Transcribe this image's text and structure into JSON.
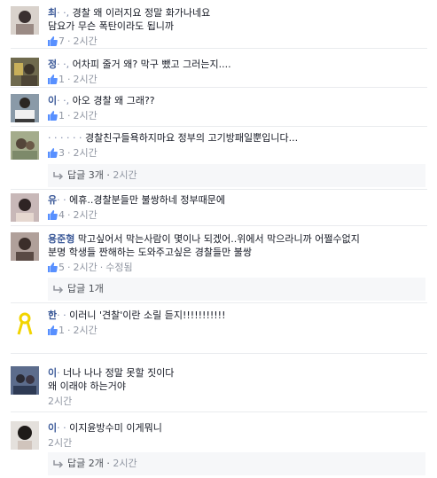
{
  "comments": [
    {
      "author": "최",
      "text": "경찰 왜 이러지요 정말 화가나네요",
      "text2": "담요가 무슨 폭탄이라도 됩니까",
      "likes": "7",
      "time": "2시간"
    },
    {
      "author": "정",
      "text": "어차피 줄거 왜? 막구 뺐고 그러는지....",
      "likes": "1",
      "time": "2시간"
    },
    {
      "author": "이",
      "text": "아오 경찰 왜 그래??",
      "likes": "1",
      "time": "2시간"
    },
    {
      "author": "",
      "text": "경찰친구들욕하지마요 정부의 고기방패일뿐입니다...",
      "likes": "3",
      "time": "2시간"
    },
    {
      "author": "유",
      "text": "에휴..경찰분들만 불쌍하네 정부때문에",
      "likes": "4",
      "time": "2시간"
    },
    {
      "author": "용준형",
      "text": "막고싶어서 막는사람이 몇이나 되겠어..위에서 막으라니까 어쩔수없지",
      "text2": "분명 학생들 짠해하는 도와주고싶은 경찰들만 불쌍",
      "likes": "5",
      "time": "2시간",
      "edited": "수정됨"
    },
    {
      "author": "한",
      "text": "이러니 '견찰'이란 소릴 듣지!!!!!!!!!!!",
      "likes": "1",
      "time": "2시간"
    },
    {
      "author": "이",
      "text": "너나 나나 정말 못할 짓이다",
      "text2": "왜 이래야 하는거야",
      "time": "2시간"
    },
    {
      "author": "이",
      "text": "이지윤방수미 이게뭐니",
      "time": "2시간"
    }
  ],
  "replies": [
    {
      "label": "답글 3개",
      "time": "2시간"
    },
    {
      "label": "답글 1개"
    },
    {
      "label": "답글 2개",
      "time": "2시간"
    }
  ],
  "colors": {
    "link": "#3b5998",
    "meta": "#9197a3",
    "text": "#141823",
    "reply_bg": "#f6f7f9"
  }
}
